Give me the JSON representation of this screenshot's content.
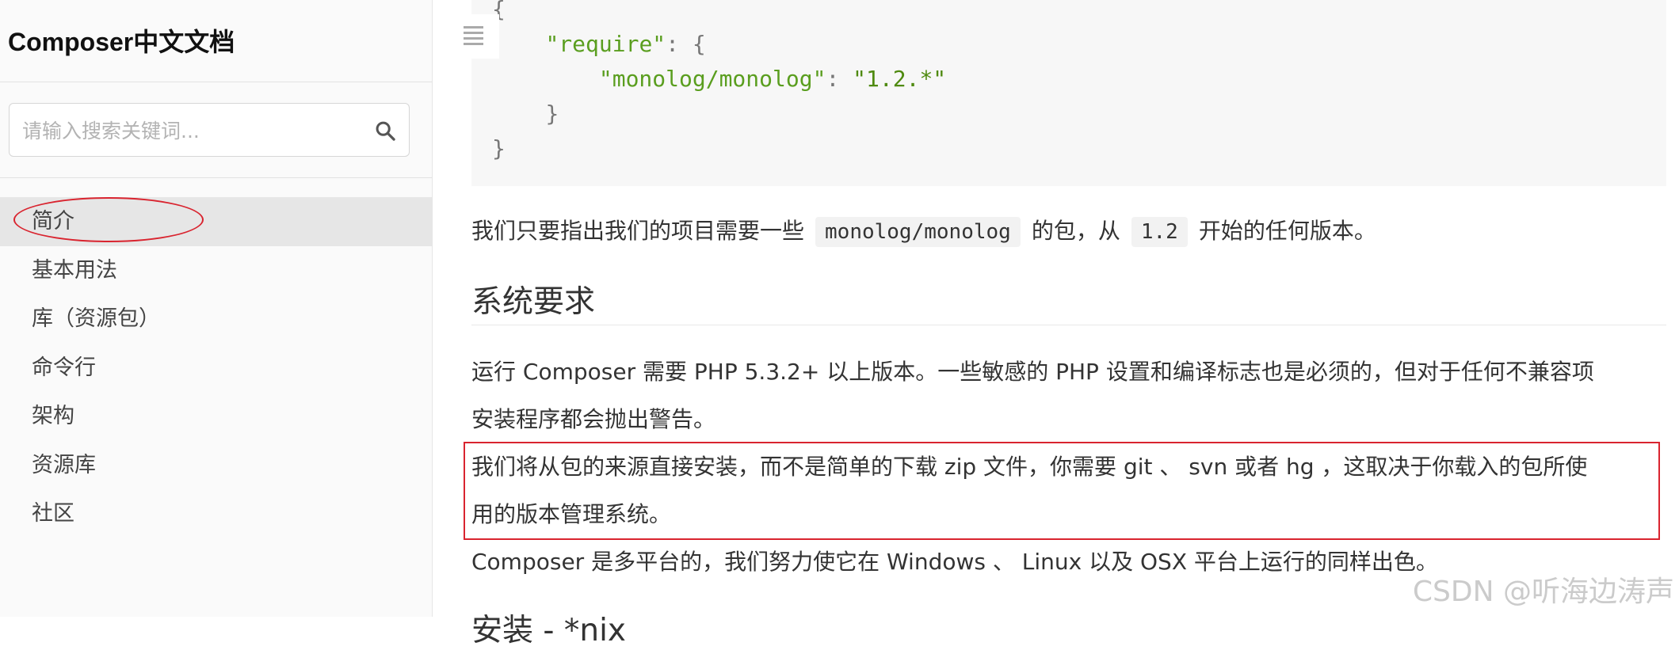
{
  "sidebar": {
    "title": "Composer中文文档",
    "search_placeholder": "请输入搜索关键词...",
    "search_icon": "search-icon",
    "items": [
      "简介",
      "基本用法",
      "库（资源包）",
      "命令行",
      "架构",
      "资源库",
      "社区"
    ],
    "active_index": 0
  },
  "code": {
    "line1": "{",
    "line2_key": "\"require\"",
    "line2_rest": ": {",
    "line3_key": "\"monolog/monolog\"",
    "line3_sep": ": ",
    "line3_val": "\"1.2.*\"",
    "line4": "}",
    "line5": "}"
  },
  "content": {
    "intro_before": "我们只要指出我们的项目需要一些",
    "intro_code1": "monolog/monolog",
    "intro_middle": "的包，从",
    "intro_code2": "1.2",
    "intro_after": "开始的任何版本。",
    "section_heading": "系统要求",
    "req_line1": "运行 Composer 需要 PHP 5.3.2+ 以上版本。一些敏感的 PHP 设置和编译标志也是必须的，但对于任何不兼容项",
    "req_line2": "安装程序都会抛出警告。",
    "install_line1": "我们将从包的来源直接安装，而不是简单的下载 zip 文件，你需要 git 、 svn 或者 hg ，这取决于你载入的包所使",
    "install_line2": "用的版本管理系统。",
    "platform_line": "Composer 是多平台的，我们努力使它在 Windows 、 Linux 以及 OSX 平台上运行的同样出色。",
    "next_heading": "安装 - *nix"
  },
  "watermark": "CSDN @听海边涛声",
  "colors": {
    "annotation_red": "#d9242f",
    "code_string_green": "#5a9e1f",
    "active_nav_bg": "#e6e6e6"
  }
}
